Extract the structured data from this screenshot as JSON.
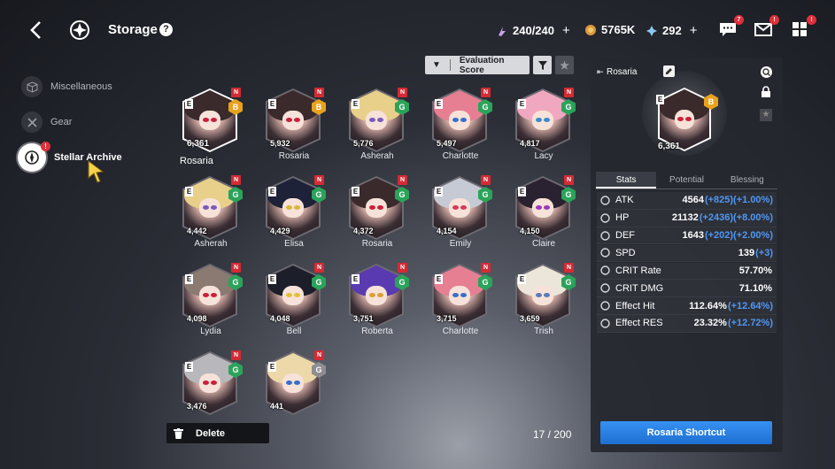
{
  "header": {
    "title": "Storage",
    "help": "?",
    "stamina": "240/240",
    "gold": "5765K",
    "crystals": "292",
    "plus": "+",
    "chat_badge": "7",
    "mail_badge": "!",
    "menu_badge": "!"
  },
  "sidebar": {
    "items": [
      {
        "label": "Miscellaneous"
      },
      {
        "label": "Gear"
      },
      {
        "label": "Stellar Archive",
        "badge": "!"
      }
    ]
  },
  "sort": {
    "label": "Evaluation Score",
    "star": "★"
  },
  "tags": {
    "e": "E",
    "n": "N"
  },
  "cards": [
    {
      "name": "Rosaria",
      "score": "6,361",
      "tier": "B",
      "tier_color": "gold",
      "hair": "#3a2a2c",
      "eye": "#c9203a"
    },
    {
      "name": "Rosaria",
      "score": "5,932",
      "tier": "B",
      "tier_color": "gold",
      "hair": "#3a2a2c",
      "eye": "#c9203a"
    },
    {
      "name": "Asherah",
      "score": "5,776",
      "tier": "G",
      "tier_color": "green",
      "hair": "#e8cf8a",
      "eye": "#7a5ab8"
    },
    {
      "name": "Charlotte",
      "score": "5,497",
      "tier": "G",
      "tier_color": "green",
      "hair": "#e77f93",
      "eye": "#3a6ec9"
    },
    {
      "name": "Lacy",
      "score": "4,817",
      "tier": "G",
      "tier_color": "green",
      "hair": "#f0a8c0",
      "eye": "#3a8ac9"
    },
    {
      "name": "Asherah",
      "score": "4,442",
      "tier": "G",
      "tier_color": "green",
      "hair": "#e8cf8a",
      "eye": "#7a5ab8"
    },
    {
      "name": "Elisa",
      "score": "4,429",
      "tier": "G",
      "tier_color": "green",
      "hair": "#1e2238",
      "eye": "#d9b53a"
    },
    {
      "name": "Rosaria",
      "score": "4,372",
      "tier": "G",
      "tier_color": "green",
      "hair": "#3a2a2c",
      "eye": "#c9203a"
    },
    {
      "name": "Emily",
      "score": "4,154",
      "tier": "G",
      "tier_color": "green",
      "hair": "#c6cad4",
      "eye": "#d43a5a"
    },
    {
      "name": "Claire",
      "score": "4,150",
      "tier": "G",
      "tier_color": "green",
      "hair": "#2a2230",
      "eye": "#9a3ab8"
    },
    {
      "name": "Lydia",
      "score": "4,098",
      "tier": "G",
      "tier_color": "green",
      "hair": "#8a7a72",
      "eye": "#c9203a"
    },
    {
      "name": "Bell",
      "score": "4,048",
      "tier": "G",
      "tier_color": "green",
      "hair": "#1c1e2a",
      "eye": "#e0c03a"
    },
    {
      "name": "Roberta",
      "score": "3,751",
      "tier": "G",
      "tier_color": "green",
      "hair": "#5a3ab0",
      "eye": "#d9a03a"
    },
    {
      "name": "Charlotte",
      "score": "3,715",
      "tier": "G",
      "tier_color": "green",
      "hair": "#e77f93",
      "eye": "#3a6ec9"
    },
    {
      "name": "Trish",
      "score": "3,659",
      "tier": "G",
      "tier_color": "green",
      "hair": "#ece6da",
      "eye": "#5a7ab8"
    },
    {
      "name": "",
      "score": "3,476",
      "tier": "G",
      "tier_color": "green",
      "hair": "#b8b8bc",
      "eye": "#c9203a"
    },
    {
      "name": "",
      "score": "441",
      "tier": "G",
      "tier_color": "grey",
      "hair": "#ecd8a8",
      "eye": "#3a6ec9"
    }
  ],
  "footer": {
    "delete_label": "Delete",
    "count": "17 / 200"
  },
  "detail": {
    "name": "Rosaria",
    "score": "6,361",
    "tier": "B",
    "tabs": [
      "Stats",
      "Potential",
      "Blessing"
    ],
    "stats": [
      {
        "label": "ATK",
        "value": "4564",
        "bonus": "(+825)(+1.00%)"
      },
      {
        "label": "HP",
        "value": "21132",
        "bonus": "(+2436)(+8.00%)"
      },
      {
        "label": "DEF",
        "value": "1643",
        "bonus": "(+202)(+2.00%)"
      },
      {
        "label": "SPD",
        "value": "139",
        "bonus": "(+3)"
      },
      {
        "label": "CRIT Rate",
        "value": "57.70%",
        "bonus": ""
      },
      {
        "label": "CRIT DMG",
        "value": "71.10%",
        "bonus": ""
      },
      {
        "label": "Effect Hit",
        "value": "112.64%",
        "bonus": "(+12.64%)"
      },
      {
        "label": "Effect RES",
        "value": "23.32%",
        "bonus": "(+12.72%)"
      }
    ],
    "shortcut_label": "Rosaria Shortcut"
  }
}
